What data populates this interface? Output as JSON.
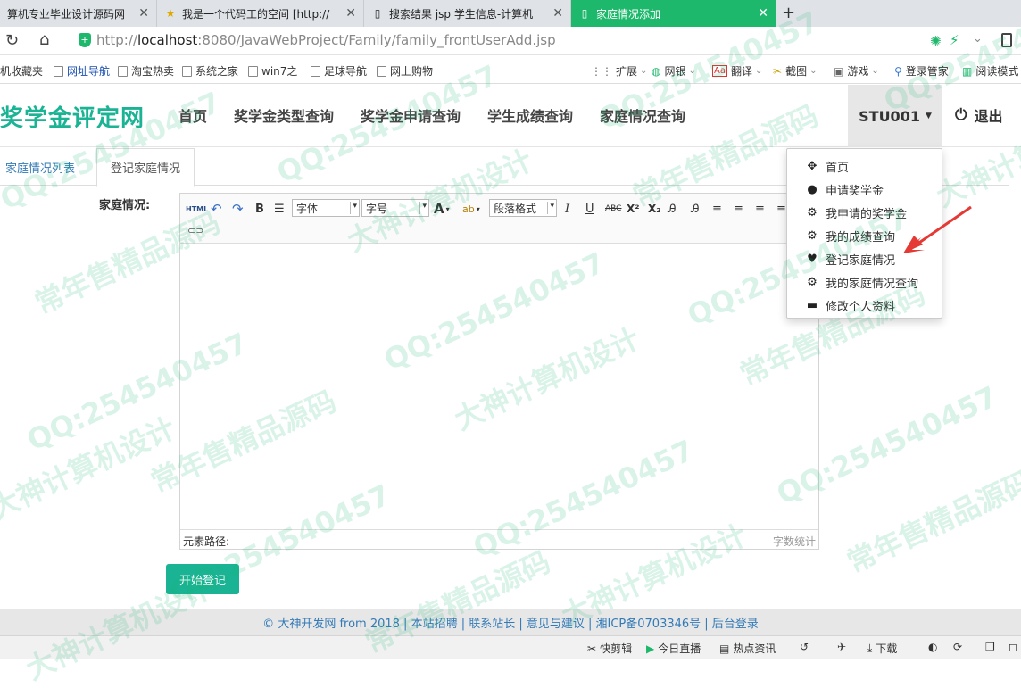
{
  "browser": {
    "tabs": [
      {
        "title": "算机专业毕业设计源码网",
        "active": false
      },
      {
        "title": "我是一个代码工的空间 [http://",
        "active": false
      },
      {
        "title": "搜索结果 jsp 学生信息-计算机",
        "active": false
      },
      {
        "title": "家庭情况添加",
        "active": true
      }
    ],
    "new_tab_label": "+",
    "close_label": "✕",
    "url_prefix": "http://",
    "url_host": "localhost",
    "url_rest": ":8080/JavaWebProject/Family/family_frontUserAdd.jsp"
  },
  "bookmarks": [
    "机收藏夹",
    "网址导航",
    "淘宝热卖",
    "系统之家",
    "win7之",
    "足球导航",
    "网上购物"
  ],
  "browser_tools": [
    "扩展",
    "网银",
    "翻译",
    "截图",
    "游戏",
    "登录管家",
    "阅读模式"
  ],
  "site": {
    "brand": "奖学金评定网",
    "nav": [
      "首页",
      "奖学金类型查询",
      "奖学金申请查询",
      "学生成绩查询",
      "家庭情况查询"
    ],
    "user": "STU001",
    "logout": "退出"
  },
  "content_tabs": {
    "list": "家庭情况列表",
    "register": "登记家庭情况"
  },
  "form": {
    "label": "家庭情况:",
    "submit": "开始登记"
  },
  "editor": {
    "html_btn": "HTML",
    "font_family": "字体",
    "font_size": "字号",
    "paragraph": "段落格式",
    "bold": "B",
    "italic": "I",
    "underline": "U",
    "strike": "ABC",
    "superscript": "X²",
    "subscript": "X₂",
    "element_path": "元素路径:",
    "word_count": "字数统计"
  },
  "dropdown": [
    {
      "icon": "move-icon",
      "glyph": "✥",
      "label": "首页"
    },
    {
      "icon": "user-icon",
      "glyph": "👤",
      "label": "申请奖学金"
    },
    {
      "icon": "gear-icon",
      "glyph": "⚙",
      "label": "我申请的奖学金"
    },
    {
      "icon": "gear-icon",
      "glyph": "⚙",
      "label": "我的成绩查询"
    },
    {
      "icon": "heart-icon",
      "glyph": "♥",
      "label": "登记家庭情况"
    },
    {
      "icon": "gear-icon",
      "glyph": "⚙",
      "label": "我的家庭情况查询"
    },
    {
      "icon": "card-icon",
      "glyph": "▬",
      "label": "修改个人资料"
    }
  ],
  "footer": "© 大神开发网 from 2018 | 本站招聘 | 联系站长 | 意见与建议 | 湘ICP备0703346号 | 后台登录",
  "statusbar": [
    "快剪辑",
    "今日直播",
    "热点资讯",
    "下载"
  ],
  "watermarks": [
    "QQ:254540457",
    "常年售精品源码",
    "大神计算机设计"
  ],
  "colors": {
    "accent": "#1ab394",
    "active_tab": "#1db86b",
    "link": "#337ab7",
    "arrow": "#e53935"
  }
}
